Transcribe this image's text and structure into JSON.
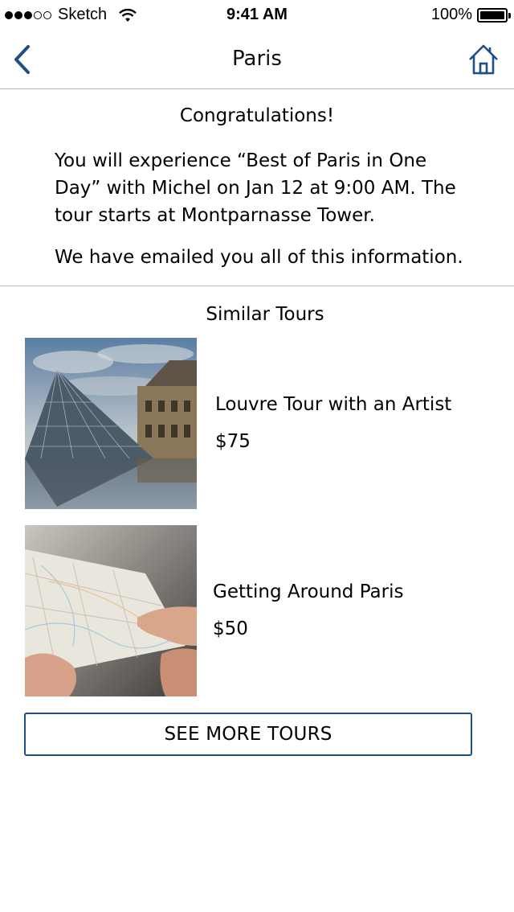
{
  "status_bar": {
    "carrier": "Sketch",
    "time": "9:41 AM",
    "battery": "100%",
    "signal_full": 3,
    "signal_total": 5
  },
  "nav": {
    "title": "Paris",
    "back_icon": "chevron-left-icon",
    "home_icon": "home-icon",
    "accent_color": "#1f4f86"
  },
  "confirmation": {
    "heading": "Congratulations!",
    "body": "You will experience “Best of Paris in One Day” with Michel on Jan 12 at 9:00 AM. The tour starts at Montparnasse Tower.",
    "email_note": "We have emailed you all of this information."
  },
  "similar": {
    "heading": "Similar Tours",
    "tours": [
      {
        "name": "Louvre Tour with an Artist",
        "price": "$75"
      },
      {
        "name": "Getting Around Paris",
        "price": "$50"
      }
    ],
    "see_more_label": "SEE MORE TOURS"
  }
}
